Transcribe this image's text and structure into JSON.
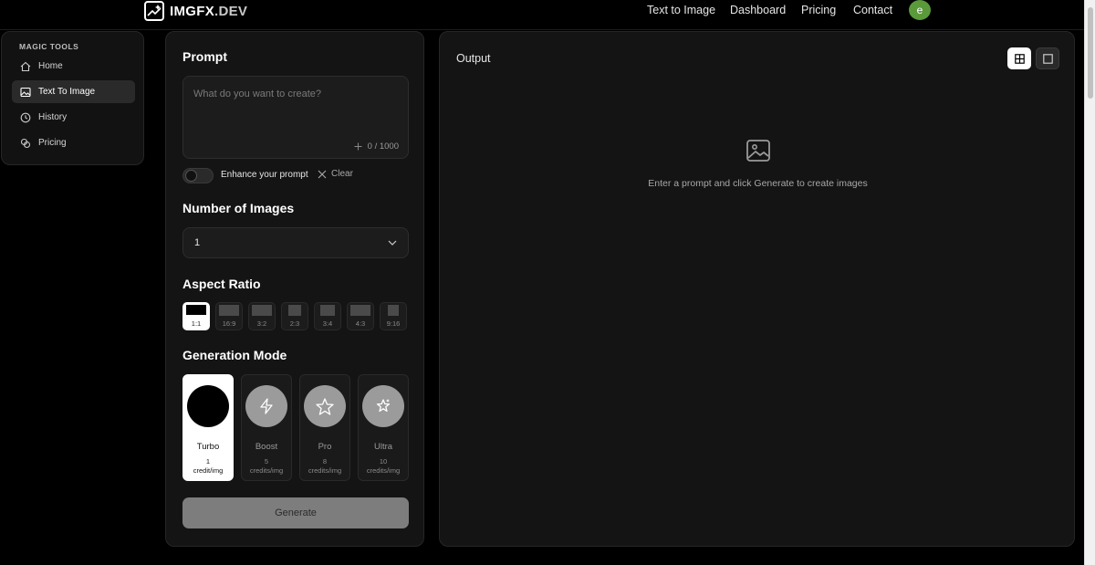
{
  "brand": {
    "name": "IMGFX",
    "suffix": ".DEV"
  },
  "nav": {
    "links": [
      "Text to Image",
      "Dashboard",
      "Pricing",
      "Contact"
    ],
    "avatar_letter": "e"
  },
  "sidebar": {
    "heading": "MAGIC TOOLS",
    "items": [
      {
        "label": "Home",
        "icon": "home-icon",
        "active": false
      },
      {
        "label": "Text To Image",
        "icon": "image-icon",
        "active": true
      },
      {
        "label": "History",
        "icon": "clock-icon",
        "active": false
      },
      {
        "label": "Pricing",
        "icon": "coins-icon",
        "active": false
      }
    ]
  },
  "prompt": {
    "title": "Prompt",
    "placeholder": "What do you want to create?",
    "value": "",
    "counter": "0 / 1000",
    "enhance_label": "Enhance your prompt",
    "enhance_on": false,
    "clear_label": "Clear"
  },
  "num_images": {
    "title": "Number of Images",
    "selected": "1"
  },
  "aspect_ratio": {
    "title": "Aspect Ratio",
    "options": [
      "1:1",
      "16:9",
      "3:2",
      "2:3",
      "3:4",
      "4:3",
      "9:16"
    ],
    "selected": "1:1"
  },
  "generation_mode": {
    "title": "Generation Mode",
    "modes": [
      {
        "name": "Turbo",
        "credits": "1",
        "unit": "credit/img",
        "icon": "turbo-icon",
        "active": true
      },
      {
        "name": "Boost",
        "credits": "5",
        "unit": "credits/img",
        "icon": "lightning-icon",
        "active": false
      },
      {
        "name": "Pro",
        "credits": "8",
        "unit": "credits/img",
        "icon": "star-icon",
        "active": false
      },
      {
        "name": "Ultra",
        "credits": "10",
        "unit": "credits/img",
        "icon": "sparkle-star-icon",
        "active": false
      }
    ]
  },
  "generate_label": "Generate",
  "output": {
    "title": "Output",
    "empty_message": "Enter a prompt and click Generate to create images",
    "view_mode": "grid"
  },
  "colors": {
    "background": "#000000",
    "panel": "#141414",
    "avatar": "#5a9a3b",
    "accent_active": "#ffffff"
  }
}
